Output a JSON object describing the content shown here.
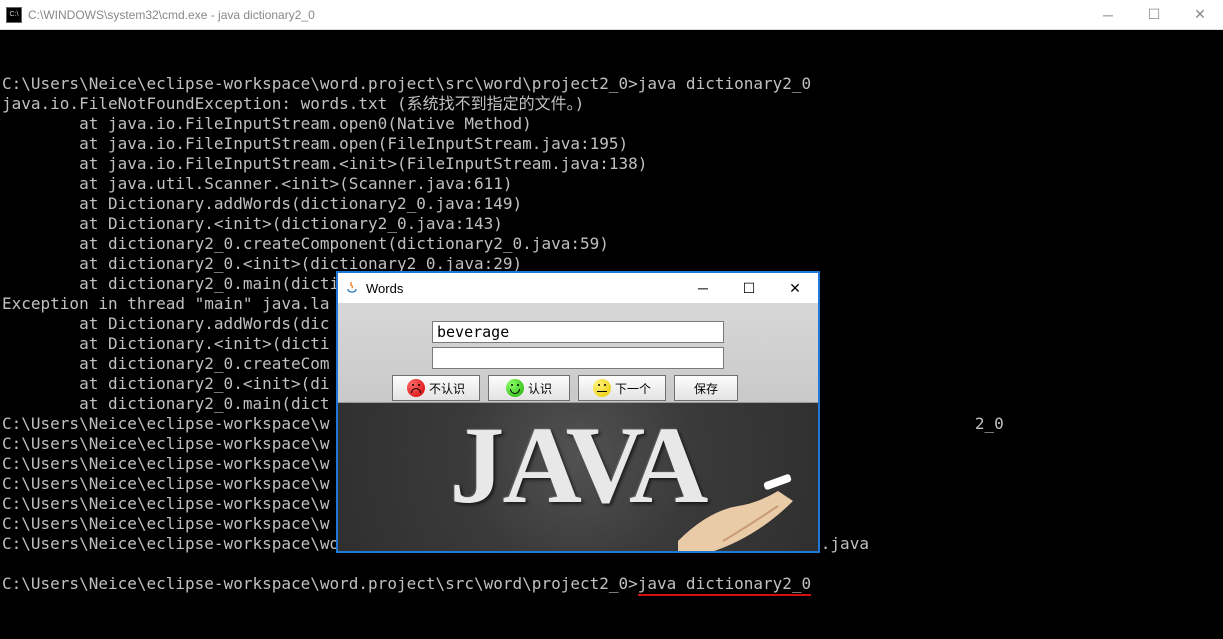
{
  "cmd": {
    "title": "C:\\WINDOWS\\system32\\cmd.exe - java  dictionary2_0",
    "icon_label": "C:\\",
    "lines_top": [
      "",
      "C:\\Users\\Neice\\eclipse-workspace\\word.project\\src\\word\\project2_0>java dictionary2_0",
      "java.io.FileNotFoundException: words.txt (系统找不到指定的文件。)",
      "        at java.io.FileInputStream.open0(Native Method)",
      "        at java.io.FileInputStream.open(FileInputStream.java:195)",
      "        at java.io.FileInputStream.<init>(FileInputStream.java:138)",
      "        at java.util.Scanner.<init>(Scanner.java:611)",
      "        at Dictionary.addWords(dictionary2_0.java:149)",
      "        at Dictionary.<init>(dictionary2_0.java:143)",
      "        at dictionary2_0.createComponent(dictionary2_0.java:59)",
      "        at dictionary2_0.<init>(dictionary2_0.java:29)",
      "        at dictionary2_0.main(dictionary2_0.java:24)",
      "Exception in thread \"main\" java.la",
      "        at Dictionary.addWords(dic",
      "        at Dictionary.<init>(dicti",
      "        at dictionary2_0.createCom",
      "        at dictionary2_0.<init>(di",
      "        at dictionary2_0.main(dict"
    ],
    "line_frag_right": "2_0",
    "lines_mid": [
      "",
      "C:\\Users\\Neice\\eclipse-workspace\\w",
      "",
      "C:\\Users\\Neice\\eclipse-workspace\\w",
      "C:\\Users\\Neice\\eclipse-workspace\\w",
      "C:\\Users\\Neice\\eclipse-workspace\\w",
      "C:\\Users\\Neice\\eclipse-workspace\\w",
      "C:\\Users\\Neice\\eclipse-workspace\\w"
    ],
    "line_after_dialog": "C:\\Users\\Neice\\eclipse-workspace\\word.project\\src\\word\\project2_0>javac dictionary2_0.java",
    "last_prompt_prefix": "C:\\Users\\Neice\\eclipse-workspace\\word.project\\src\\word\\project2_0>",
    "last_command": "java dictionary2_0"
  },
  "swing": {
    "title": "Words",
    "input1_value": "beverage",
    "input2_value": "",
    "btn_unknown": "不认识",
    "btn_known": "认识",
    "btn_next": "下一个",
    "btn_save": "保存",
    "bg_text": "JAVA"
  }
}
